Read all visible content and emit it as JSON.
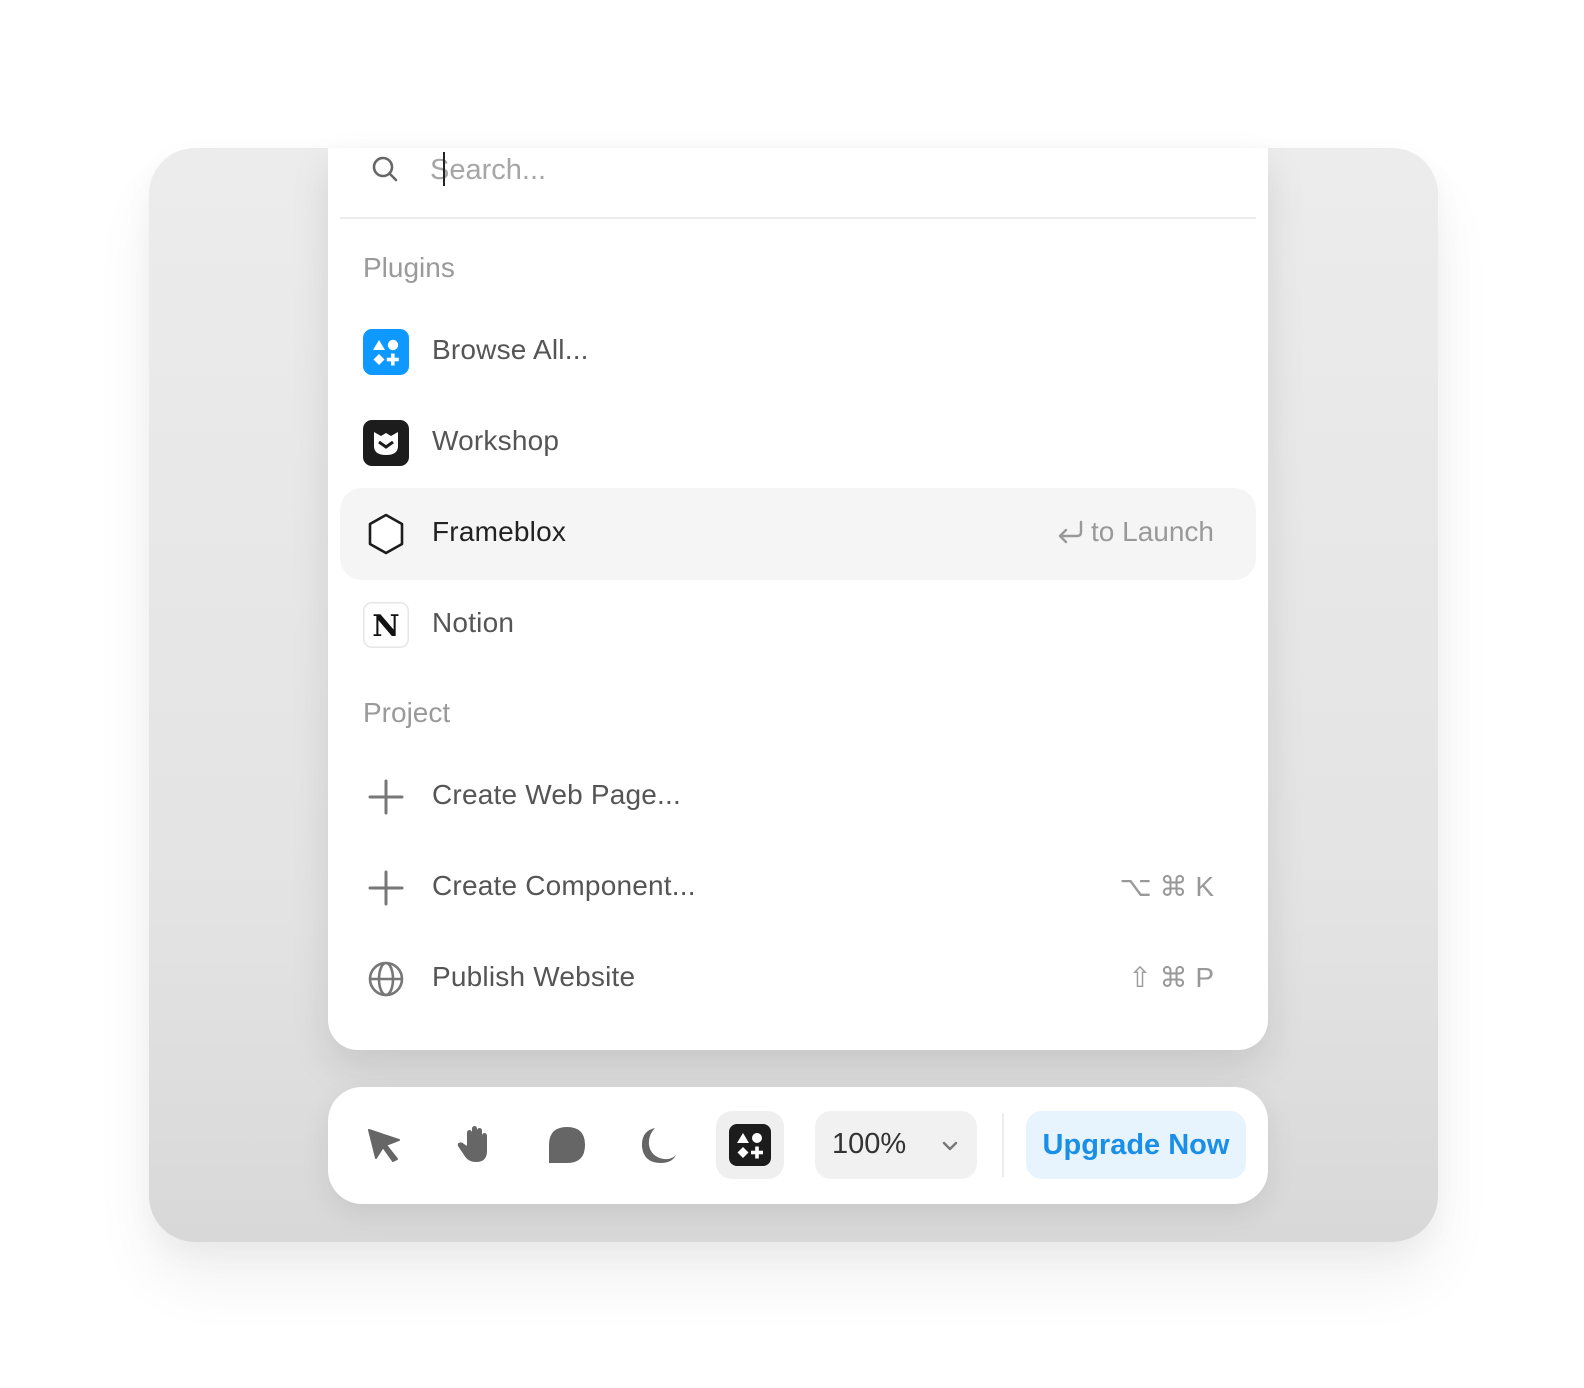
{
  "search": {
    "placeholder": "Search..."
  },
  "sections": {
    "plugins_label": "Plugins",
    "project_label": "Project"
  },
  "plugins": [
    {
      "label": "Browse All...",
      "icon": "browse-plugins-icon"
    },
    {
      "label": "Workshop",
      "icon": "workshop-logo-icon"
    },
    {
      "label": "Frameblox",
      "icon": "frameblox-hexagon-icon",
      "hint": "to Launch",
      "active": true
    },
    {
      "label": "Notion",
      "icon": "notion-logo-icon"
    }
  ],
  "project": [
    {
      "label": "Create Web Page...",
      "icon": "plus-icon"
    },
    {
      "label": "Create Component...",
      "icon": "plus-icon",
      "shortcut": "⌥ ⌘ K"
    },
    {
      "label": "Publish Website",
      "icon": "globe-icon",
      "shortcut": "⇧ ⌘ P"
    }
  ],
  "toolbar": {
    "zoom": "100%",
    "upgrade_label": "Upgrade Now"
  },
  "colors": {
    "accent": "#1a8fe8",
    "accent_bg": "#e8f4fd",
    "plugin_blue": "#0d99ff"
  }
}
